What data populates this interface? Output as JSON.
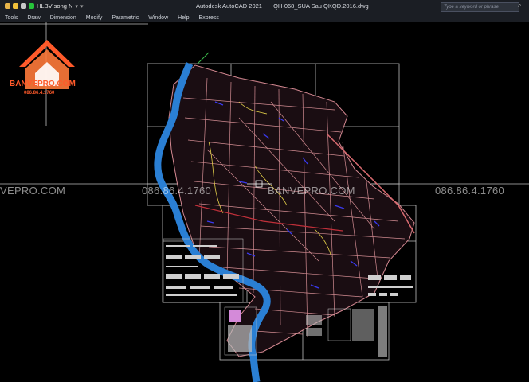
{
  "titlebar": {
    "layer_name": "HLBV song N",
    "app_title": "Autodesk AutoCAD 2021",
    "file_name": "QH-068_SUA Sau QKQD.2016.dwg",
    "search_placeholder": "Type a keyword or phrase"
  },
  "menu": [
    "Tools",
    "Draw",
    "Dimension",
    "Modify",
    "Parametric",
    "Window",
    "Help",
    "Express"
  ],
  "brand": {
    "name": "BANVEPRO.COM",
    "phone": "086.86.4.1760"
  },
  "watermarks": {
    "left": "VEPRO.COM",
    "center_phone": "086.86.4.1760",
    "center_site": "BANVEPRO.COM",
    "right_phone": "086.86.4.1760"
  },
  "colors": {
    "background": "#000000",
    "river": "#2a7fd4",
    "roads": "#e79aa0",
    "brand": "#ff5a2a"
  }
}
